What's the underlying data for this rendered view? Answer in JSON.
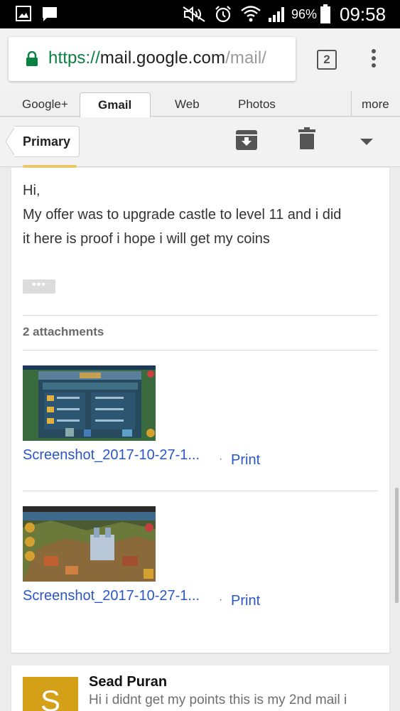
{
  "status_bar": {
    "battery": "96%",
    "time": "09:58",
    "icons": [
      "gallery-icon",
      "message-icon",
      "mute-icon",
      "alarm-icon",
      "wifi-icon",
      "signal-icon",
      "battery-icon"
    ]
  },
  "browser": {
    "url_scheme": "https://",
    "url_host": "mail.google.com",
    "url_path": "/mail/",
    "tab_count": "2"
  },
  "google_nav": {
    "tabs": [
      "Google+",
      "Gmail",
      "Web",
      "Photos"
    ],
    "active_tab": "Gmail",
    "more_label": "more"
  },
  "toolbar": {
    "label_chip": "Primary",
    "icons": [
      "archive-icon",
      "delete-icon",
      "dropdown-icon"
    ]
  },
  "message": {
    "greeting": "Hi,",
    "line1": "My offer was to upgrade castle to level 11 and i did",
    "line2": "it here is proof i hope i will get my coins",
    "show_trimmed": "•••",
    "attachments_label": "2 attachments",
    "attachments": [
      {
        "name": "Screenshot_2017-10-27-1...",
        "separator": "·",
        "print_label": "Print"
      },
      {
        "name": "Screenshot_2017-10-27-1...",
        "separator": "·",
        "print_label": "Print"
      }
    ]
  },
  "next_message": {
    "avatar_letter": "S",
    "sender": "Sead Puran",
    "snippet": "Hi i didnt get my points this is my 2nd mail i"
  },
  "colors": {
    "link_blue": "#2a56c6",
    "secure_green": "#0b8043",
    "avatar_gold": "#d4a017"
  }
}
